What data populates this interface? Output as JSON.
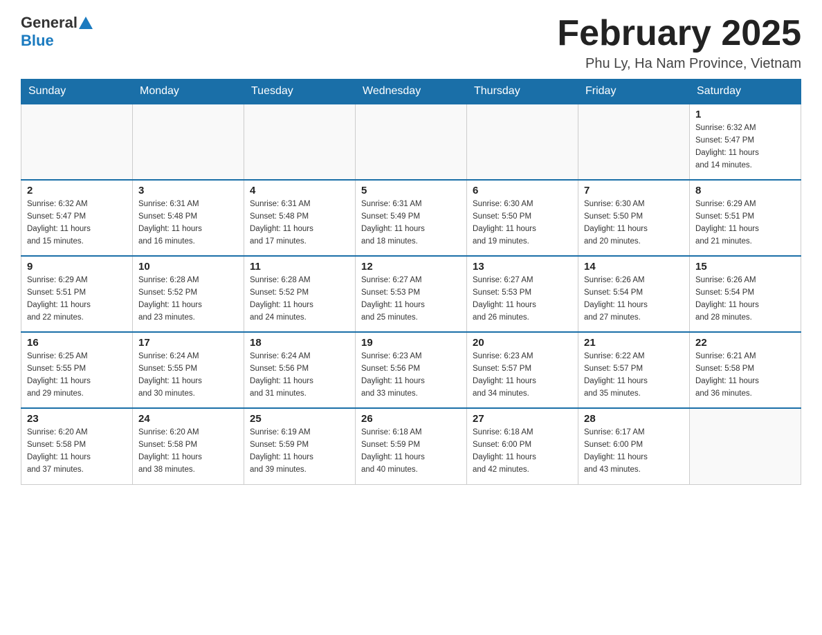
{
  "header": {
    "logo_general": "General",
    "logo_blue": "Blue",
    "month_title": "February 2025",
    "location": "Phu Ly, Ha Nam Province, Vietnam"
  },
  "days_of_week": [
    "Sunday",
    "Monday",
    "Tuesday",
    "Wednesday",
    "Thursday",
    "Friday",
    "Saturday"
  ],
  "weeks": [
    [
      {
        "day": "",
        "info": ""
      },
      {
        "day": "",
        "info": ""
      },
      {
        "day": "",
        "info": ""
      },
      {
        "day": "",
        "info": ""
      },
      {
        "day": "",
        "info": ""
      },
      {
        "day": "",
        "info": ""
      },
      {
        "day": "1",
        "info": "Sunrise: 6:32 AM\nSunset: 5:47 PM\nDaylight: 11 hours\nand 14 minutes."
      }
    ],
    [
      {
        "day": "2",
        "info": "Sunrise: 6:32 AM\nSunset: 5:47 PM\nDaylight: 11 hours\nand 15 minutes."
      },
      {
        "day": "3",
        "info": "Sunrise: 6:31 AM\nSunset: 5:48 PM\nDaylight: 11 hours\nand 16 minutes."
      },
      {
        "day": "4",
        "info": "Sunrise: 6:31 AM\nSunset: 5:48 PM\nDaylight: 11 hours\nand 17 minutes."
      },
      {
        "day": "5",
        "info": "Sunrise: 6:31 AM\nSunset: 5:49 PM\nDaylight: 11 hours\nand 18 minutes."
      },
      {
        "day": "6",
        "info": "Sunrise: 6:30 AM\nSunset: 5:50 PM\nDaylight: 11 hours\nand 19 minutes."
      },
      {
        "day": "7",
        "info": "Sunrise: 6:30 AM\nSunset: 5:50 PM\nDaylight: 11 hours\nand 20 minutes."
      },
      {
        "day": "8",
        "info": "Sunrise: 6:29 AM\nSunset: 5:51 PM\nDaylight: 11 hours\nand 21 minutes."
      }
    ],
    [
      {
        "day": "9",
        "info": "Sunrise: 6:29 AM\nSunset: 5:51 PM\nDaylight: 11 hours\nand 22 minutes."
      },
      {
        "day": "10",
        "info": "Sunrise: 6:28 AM\nSunset: 5:52 PM\nDaylight: 11 hours\nand 23 minutes."
      },
      {
        "day": "11",
        "info": "Sunrise: 6:28 AM\nSunset: 5:52 PM\nDaylight: 11 hours\nand 24 minutes."
      },
      {
        "day": "12",
        "info": "Sunrise: 6:27 AM\nSunset: 5:53 PM\nDaylight: 11 hours\nand 25 minutes."
      },
      {
        "day": "13",
        "info": "Sunrise: 6:27 AM\nSunset: 5:53 PM\nDaylight: 11 hours\nand 26 minutes."
      },
      {
        "day": "14",
        "info": "Sunrise: 6:26 AM\nSunset: 5:54 PM\nDaylight: 11 hours\nand 27 minutes."
      },
      {
        "day": "15",
        "info": "Sunrise: 6:26 AM\nSunset: 5:54 PM\nDaylight: 11 hours\nand 28 minutes."
      }
    ],
    [
      {
        "day": "16",
        "info": "Sunrise: 6:25 AM\nSunset: 5:55 PM\nDaylight: 11 hours\nand 29 minutes."
      },
      {
        "day": "17",
        "info": "Sunrise: 6:24 AM\nSunset: 5:55 PM\nDaylight: 11 hours\nand 30 minutes."
      },
      {
        "day": "18",
        "info": "Sunrise: 6:24 AM\nSunset: 5:56 PM\nDaylight: 11 hours\nand 31 minutes."
      },
      {
        "day": "19",
        "info": "Sunrise: 6:23 AM\nSunset: 5:56 PM\nDaylight: 11 hours\nand 33 minutes."
      },
      {
        "day": "20",
        "info": "Sunrise: 6:23 AM\nSunset: 5:57 PM\nDaylight: 11 hours\nand 34 minutes."
      },
      {
        "day": "21",
        "info": "Sunrise: 6:22 AM\nSunset: 5:57 PM\nDaylight: 11 hours\nand 35 minutes."
      },
      {
        "day": "22",
        "info": "Sunrise: 6:21 AM\nSunset: 5:58 PM\nDaylight: 11 hours\nand 36 minutes."
      }
    ],
    [
      {
        "day": "23",
        "info": "Sunrise: 6:20 AM\nSunset: 5:58 PM\nDaylight: 11 hours\nand 37 minutes."
      },
      {
        "day": "24",
        "info": "Sunrise: 6:20 AM\nSunset: 5:58 PM\nDaylight: 11 hours\nand 38 minutes."
      },
      {
        "day": "25",
        "info": "Sunrise: 6:19 AM\nSunset: 5:59 PM\nDaylight: 11 hours\nand 39 minutes."
      },
      {
        "day": "26",
        "info": "Sunrise: 6:18 AM\nSunset: 5:59 PM\nDaylight: 11 hours\nand 40 minutes."
      },
      {
        "day": "27",
        "info": "Sunrise: 6:18 AM\nSunset: 6:00 PM\nDaylight: 11 hours\nand 42 minutes."
      },
      {
        "day": "28",
        "info": "Sunrise: 6:17 AM\nSunset: 6:00 PM\nDaylight: 11 hours\nand 43 minutes."
      },
      {
        "day": "",
        "info": ""
      }
    ]
  ]
}
